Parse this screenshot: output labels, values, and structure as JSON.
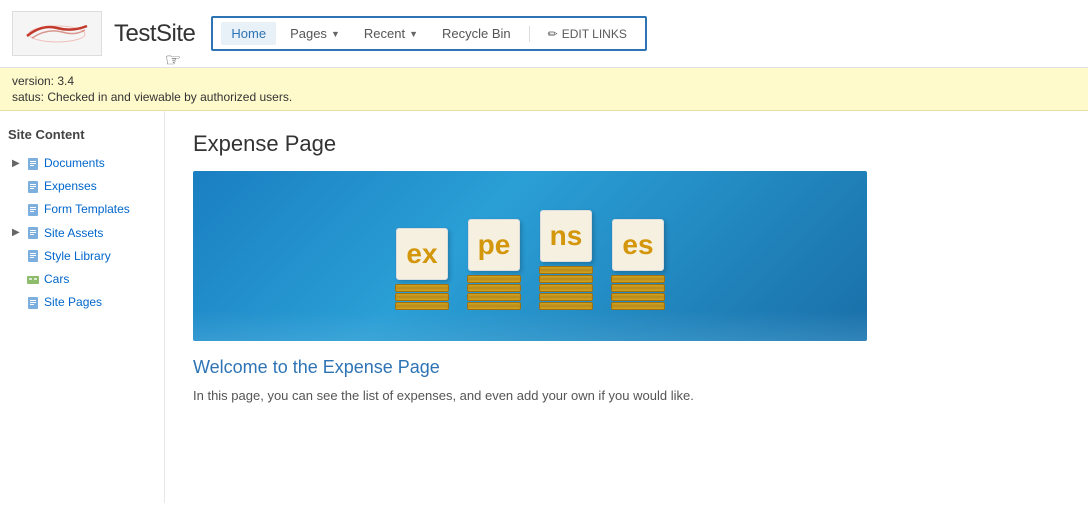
{
  "header": {
    "site_title": "TestSite",
    "logo_alt": "site logo"
  },
  "nav": {
    "items": [
      {
        "id": "home",
        "label": "Home",
        "active": true,
        "has_dropdown": false
      },
      {
        "id": "pages",
        "label": "Pages",
        "active": false,
        "has_dropdown": true
      },
      {
        "id": "recent",
        "label": "Recent",
        "active": false,
        "has_dropdown": true
      },
      {
        "id": "recycle-bin",
        "label": "Recycle Bin",
        "active": false,
        "has_dropdown": false
      }
    ],
    "edit_links_label": "EDIT LINKS"
  },
  "status_bar": {
    "version_label": "ersion:",
    "version_value": "3.4",
    "status_label": "atus:",
    "status_value": "Checked in and viewable by authorized users."
  },
  "sidebar": {
    "title": "Site Content",
    "items": [
      {
        "id": "documents",
        "label": "Documents",
        "icon": "folder",
        "expandable": true
      },
      {
        "id": "expenses",
        "label": "Expenses",
        "icon": "list",
        "expandable": false
      },
      {
        "id": "form-templates",
        "label": "Form Templates",
        "icon": "list",
        "expandable": false
      },
      {
        "id": "site-assets",
        "label": "Site Assets",
        "icon": "folder",
        "expandable": true
      },
      {
        "id": "style-library",
        "label": "Style Library",
        "icon": "list",
        "expandable": false
      },
      {
        "id": "cars",
        "label": "Cars",
        "icon": "image",
        "expandable": false
      },
      {
        "id": "site-pages",
        "label": "Site Pages",
        "icon": "list",
        "expandable": false
      }
    ]
  },
  "content": {
    "page_title": "Expense Page",
    "expense_letters": [
      "ex",
      "pe",
      "ns",
      "es"
    ],
    "coin_stack_heights": [
      3,
      4,
      5,
      4
    ],
    "welcome_title": "Welcome to the Expense Page",
    "welcome_text": "In this page, you can see the list of expenses, and even add your own if you would like."
  }
}
